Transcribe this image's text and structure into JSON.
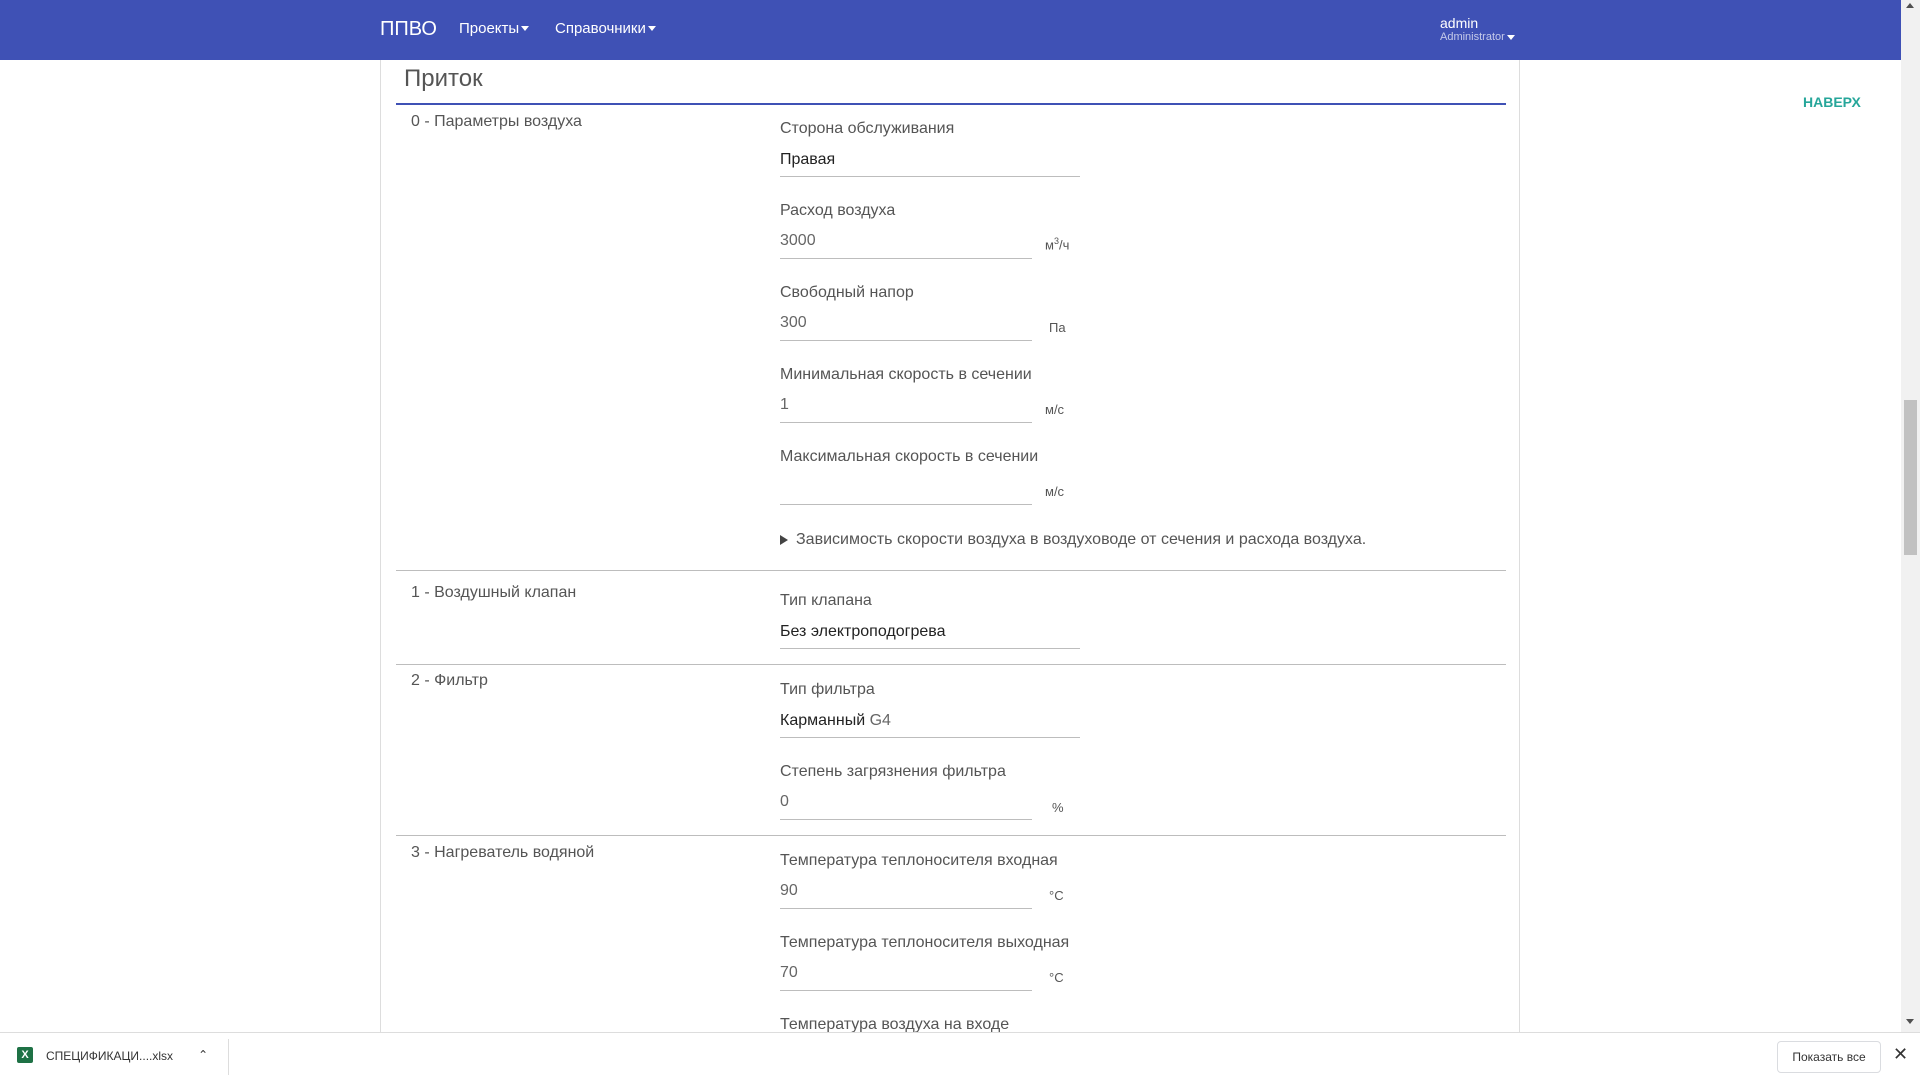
{
  "nav": {
    "brand": "ППВО",
    "menu": [
      "Проекты",
      "Справочники"
    ],
    "user": "admin",
    "role": "Administrator"
  },
  "to_top": "НАВЕРХ",
  "section_title": "Приток",
  "groups": [
    {
      "label": "0 - Параметры воздуха",
      "fields": [
        {
          "label": "Сторона обслуживания",
          "value": "Правая",
          "type": "select"
        },
        {
          "label": "Расход воздуха",
          "value": "3000",
          "unit_base": "м",
          "unit_sup": "3",
          "unit_tail": "/ч",
          "type": "input"
        },
        {
          "label": "Свободный напор",
          "value": "300",
          "unit": "Па",
          "type": "input"
        },
        {
          "label": "Минимальная скорость в сечении",
          "value": "1",
          "unit": "м/с",
          "type": "input"
        },
        {
          "label": "Максимальная скорость в сечении",
          "value": "",
          "unit": "м/с",
          "type": "input"
        }
      ],
      "collapsible": "Зависимость скорости воздуха в воздуховоде от сечения и расхода воздуха."
    },
    {
      "label": "1 - Воздушный клапан",
      "fields": [
        {
          "label": "Тип клапана",
          "value": "Без электроподогрева",
          "type": "select"
        }
      ]
    },
    {
      "label": "2 - Фильтр",
      "fields": [
        {
          "label": "Тип фильтра",
          "value": "Карманный",
          "value_suffix": "G4",
          "type": "select"
        },
        {
          "label": "Степень загрязнения фильтра",
          "value": "0",
          "unit": "%",
          "type": "input"
        }
      ]
    },
    {
      "label": "3 - Нагреватель водяной",
      "fields": [
        {
          "label": "Температура теплоносителя входная",
          "value": "90",
          "unit": "°C",
          "type": "input"
        },
        {
          "label": "Температура теплоносителя выходная",
          "value": "70",
          "unit": "°C",
          "type": "input"
        },
        {
          "label": "Температура воздуха на входе",
          "type": "input"
        }
      ]
    }
  ],
  "download_bar": {
    "file_name": "СПЕЦИФИКАЦИ....xlsx",
    "show_all": "Показать все"
  },
  "colors": {
    "nav_bg": "#3f51b5",
    "accent_teal": "#26a69a",
    "title_rule": "#3f51b5"
  }
}
